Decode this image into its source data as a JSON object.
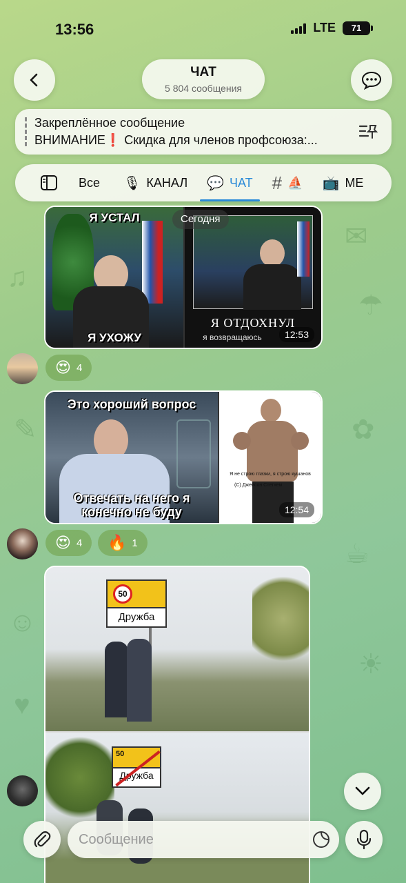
{
  "status": {
    "time": "13:56",
    "network": "LTE",
    "battery": "71"
  },
  "header": {
    "title": "ЧАТ",
    "subtitle": "5 804 сообщения"
  },
  "pinned": {
    "title": "Закреплённое сообщение",
    "text": "ВНИМАНИЕ❗️ Скидка для членов профсоюза:..."
  },
  "tabs": [
    {
      "label": "Все",
      "icon": "folder-icon"
    },
    {
      "label": "КАНАЛ",
      "icon": "microphone-icon"
    },
    {
      "label": "ЧАТ",
      "icon": "speech-bubble-icon",
      "active": true
    },
    {
      "label": "⛵",
      "icon": "hashtag-icon"
    },
    {
      "label": "МЕ",
      "icon": "tv-icon"
    }
  ],
  "date_chip": "Сегодня",
  "messages": [
    {
      "left_caption_top": "Я УСТАЛ",
      "left_caption_bottom": "Я УХОЖУ",
      "right_caption_main": "Я ОТДОХНУЛ",
      "right_caption_sub": "я возвращаюсь",
      "time": "12:53",
      "reactions": [
        {
          "emoji": "😍",
          "count": "4"
        }
      ]
    },
    {
      "left_caption_top": "Это хороший вопрос",
      "left_caption_bottom": "Отвечать на него я конечно не буду",
      "right_quote": "Я не строю глазки, я строю кушанов",
      "right_author": "(С) Джейсон Стетхем",
      "time": "12:54",
      "reactions": [
        {
          "emoji": "😍",
          "count": "4"
        },
        {
          "emoji": "🔥",
          "count": "1"
        }
      ]
    },
    {
      "sign_top_speed": "50",
      "sign_top_name": "Дружба",
      "sign_bottom_speed": "50",
      "sign_bottom_name": "Дружба"
    }
  ],
  "input": {
    "placeholder": "Сообщение"
  },
  "colors": {
    "accent": "#2a8ad8",
    "reaction_bg": "#78aa5a"
  }
}
